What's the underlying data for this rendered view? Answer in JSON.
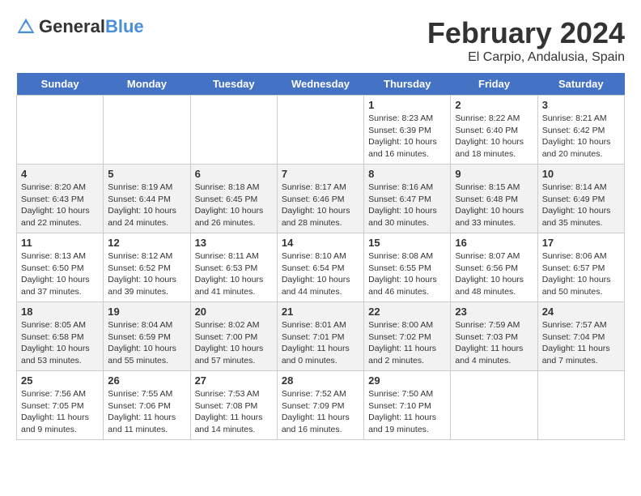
{
  "header": {
    "logo_general": "General",
    "logo_blue": "Blue",
    "title": "February 2024",
    "subtitle": "El Carpio, Andalusia, Spain"
  },
  "calendar": {
    "days": [
      "Sunday",
      "Monday",
      "Tuesday",
      "Wednesday",
      "Thursday",
      "Friday",
      "Saturday"
    ],
    "weeks": [
      [
        {
          "date": "",
          "content": ""
        },
        {
          "date": "",
          "content": ""
        },
        {
          "date": "",
          "content": ""
        },
        {
          "date": "",
          "content": ""
        },
        {
          "date": "1",
          "content": "Sunrise: 8:23 AM\nSunset: 6:39 PM\nDaylight: 10 hours\nand 16 minutes."
        },
        {
          "date": "2",
          "content": "Sunrise: 8:22 AM\nSunset: 6:40 PM\nDaylight: 10 hours\nand 18 minutes."
        },
        {
          "date": "3",
          "content": "Sunrise: 8:21 AM\nSunset: 6:42 PM\nDaylight: 10 hours\nand 20 minutes."
        }
      ],
      [
        {
          "date": "4",
          "content": "Sunrise: 8:20 AM\nSunset: 6:43 PM\nDaylight: 10 hours\nand 22 minutes."
        },
        {
          "date": "5",
          "content": "Sunrise: 8:19 AM\nSunset: 6:44 PM\nDaylight: 10 hours\nand 24 minutes."
        },
        {
          "date": "6",
          "content": "Sunrise: 8:18 AM\nSunset: 6:45 PM\nDaylight: 10 hours\nand 26 minutes."
        },
        {
          "date": "7",
          "content": "Sunrise: 8:17 AM\nSunset: 6:46 PM\nDaylight: 10 hours\nand 28 minutes."
        },
        {
          "date": "8",
          "content": "Sunrise: 8:16 AM\nSunset: 6:47 PM\nDaylight: 10 hours\nand 30 minutes."
        },
        {
          "date": "9",
          "content": "Sunrise: 8:15 AM\nSunset: 6:48 PM\nDaylight: 10 hours\nand 33 minutes."
        },
        {
          "date": "10",
          "content": "Sunrise: 8:14 AM\nSunset: 6:49 PM\nDaylight: 10 hours\nand 35 minutes."
        }
      ],
      [
        {
          "date": "11",
          "content": "Sunrise: 8:13 AM\nSunset: 6:50 PM\nDaylight: 10 hours\nand 37 minutes."
        },
        {
          "date": "12",
          "content": "Sunrise: 8:12 AM\nSunset: 6:52 PM\nDaylight: 10 hours\nand 39 minutes."
        },
        {
          "date": "13",
          "content": "Sunrise: 8:11 AM\nSunset: 6:53 PM\nDaylight: 10 hours\nand 41 minutes."
        },
        {
          "date": "14",
          "content": "Sunrise: 8:10 AM\nSunset: 6:54 PM\nDaylight: 10 hours\nand 44 minutes."
        },
        {
          "date": "15",
          "content": "Sunrise: 8:08 AM\nSunset: 6:55 PM\nDaylight: 10 hours\nand 46 minutes."
        },
        {
          "date": "16",
          "content": "Sunrise: 8:07 AM\nSunset: 6:56 PM\nDaylight: 10 hours\nand 48 minutes."
        },
        {
          "date": "17",
          "content": "Sunrise: 8:06 AM\nSunset: 6:57 PM\nDaylight: 10 hours\nand 50 minutes."
        }
      ],
      [
        {
          "date": "18",
          "content": "Sunrise: 8:05 AM\nSunset: 6:58 PM\nDaylight: 10 hours\nand 53 minutes."
        },
        {
          "date": "19",
          "content": "Sunrise: 8:04 AM\nSunset: 6:59 PM\nDaylight: 10 hours\nand 55 minutes."
        },
        {
          "date": "20",
          "content": "Sunrise: 8:02 AM\nSunset: 7:00 PM\nDaylight: 10 hours\nand 57 minutes."
        },
        {
          "date": "21",
          "content": "Sunrise: 8:01 AM\nSunset: 7:01 PM\nDaylight: 11 hours\nand 0 minutes."
        },
        {
          "date": "22",
          "content": "Sunrise: 8:00 AM\nSunset: 7:02 PM\nDaylight: 11 hours\nand 2 minutes."
        },
        {
          "date": "23",
          "content": "Sunrise: 7:59 AM\nSunset: 7:03 PM\nDaylight: 11 hours\nand 4 minutes."
        },
        {
          "date": "24",
          "content": "Sunrise: 7:57 AM\nSunset: 7:04 PM\nDaylight: 11 hours\nand 7 minutes."
        }
      ],
      [
        {
          "date": "25",
          "content": "Sunrise: 7:56 AM\nSunset: 7:05 PM\nDaylight: 11 hours\nand 9 minutes."
        },
        {
          "date": "26",
          "content": "Sunrise: 7:55 AM\nSunset: 7:06 PM\nDaylight: 11 hours\nand 11 minutes."
        },
        {
          "date": "27",
          "content": "Sunrise: 7:53 AM\nSunset: 7:08 PM\nDaylight: 11 hours\nand 14 minutes."
        },
        {
          "date": "28",
          "content": "Sunrise: 7:52 AM\nSunset: 7:09 PM\nDaylight: 11 hours\nand 16 minutes."
        },
        {
          "date": "29",
          "content": "Sunrise: 7:50 AM\nSunset: 7:10 PM\nDaylight: 11 hours\nand 19 minutes."
        },
        {
          "date": "",
          "content": ""
        },
        {
          "date": "",
          "content": ""
        }
      ]
    ]
  }
}
